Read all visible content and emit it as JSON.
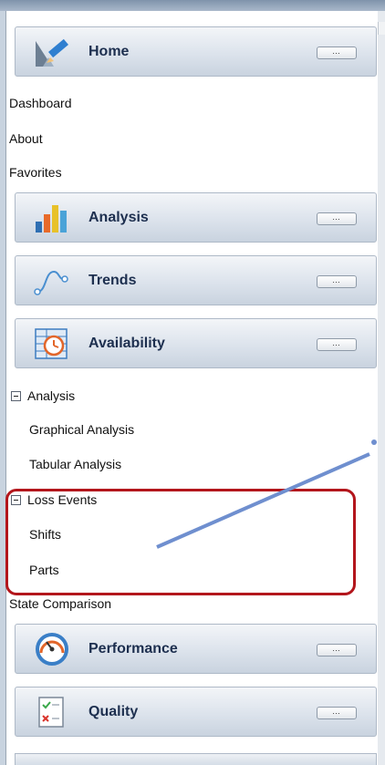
{
  "nav": {
    "home": {
      "label": "Home",
      "icon": "home-pencil-icon"
    },
    "home_items": [
      "Dashboard",
      "About",
      "Favorites"
    ],
    "analysis": {
      "label": "Analysis",
      "icon": "bar-chart-icon"
    },
    "trends": {
      "label": "Trends",
      "icon": "trend-curve-icon"
    },
    "availability": {
      "label": "Availability",
      "icon": "clock-table-icon"
    },
    "availability_tree": {
      "group1": "Analysis",
      "group1_items": [
        "Graphical Analysis",
        "Tabular Analysis"
      ],
      "group2": "Loss Events",
      "group2_items": [
        "Shifts",
        "Parts"
      ],
      "extra": "State Comparison"
    },
    "performance": {
      "label": "Performance",
      "icon": "gauge-icon"
    },
    "quality": {
      "label": "Quality",
      "icon": "checklist-icon"
    },
    "more_label": "…"
  },
  "colors": {
    "highlight": "#b3161c",
    "arrow": "#6f8fcf",
    "header_text": "#1d2f4f"
  }
}
